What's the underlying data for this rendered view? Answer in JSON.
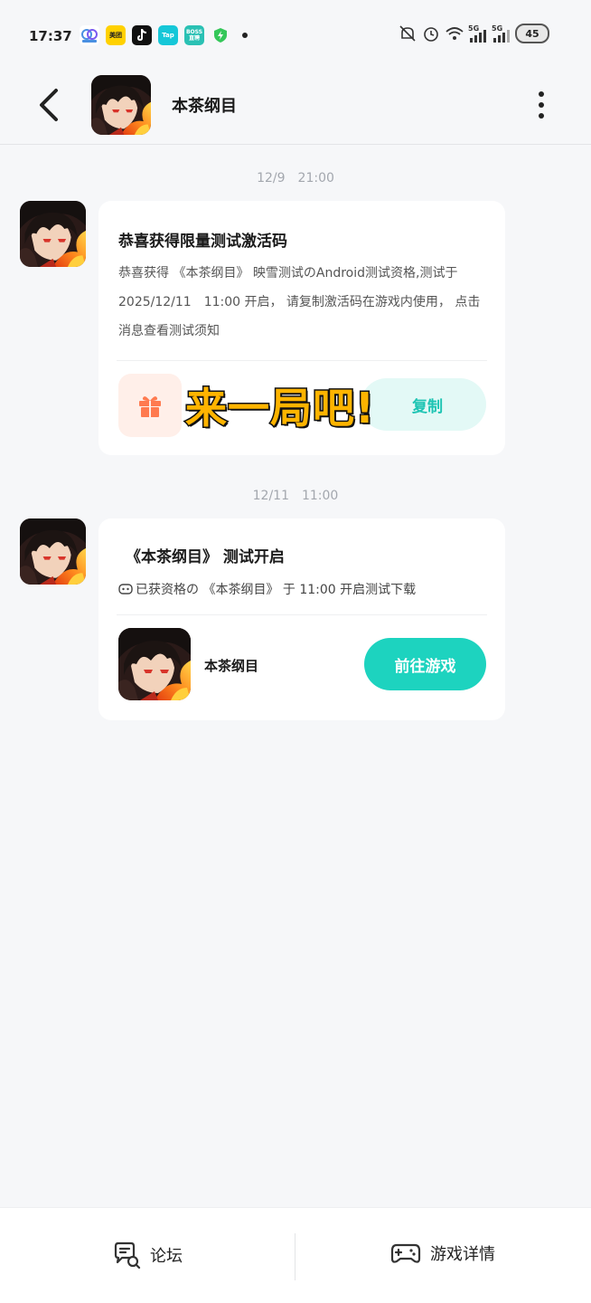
{
  "status_bar": {
    "time": "17:37",
    "app_icons": [
      {
        "name": "app-notify-icon",
        "label": "",
        "color": "#4a90e2"
      },
      {
        "name": "meituan-icon",
        "label": "美团",
        "color": "#ffd100"
      },
      {
        "name": "douyin-icon",
        "label": "",
        "color": "#111111"
      },
      {
        "name": "taptap-icon",
        "label": "Tap",
        "color": "#16c7d8"
      },
      {
        "name": "boss-zhipin-icon",
        "label": "BOSS 直聘",
        "color": "#2ac1b4"
      },
      {
        "name": "shield-icon",
        "label": "",
        "color": "#34c759"
      }
    ],
    "battery": "45"
  },
  "header": {
    "title": "本茶纲目"
  },
  "messages": [
    {
      "timestamp": "12/9　21:00",
      "title": "恭喜获得限量测试激活码",
      "body": "恭喜获得 《本茶纲目》 映雪测试のAndroid测试资格,测试于 2025/12/11　11:00 开启， 请复制激活码在游戏内使用， 点击消息查看测试须知",
      "copy_label": "复制"
    },
    {
      "timestamp": "12/11　11:00",
      "title": "《本茶纲目》 测试开启",
      "subtitle": "已获资格の 《本茶纲目》 于 11:00 开启测试下载",
      "game_name": "本茶纲目",
      "play_label": "前往游戏"
    }
  ],
  "overlay": {
    "text": "来一局吧!"
  },
  "bottom_bar": {
    "forum_label": "论坛",
    "details_label": "游戏详情"
  },
  "colors": {
    "accent": "#1dd3bf",
    "accent_light": "#e3f9f6",
    "gift": "#ff7a4f",
    "overlay": "#ffb400"
  }
}
